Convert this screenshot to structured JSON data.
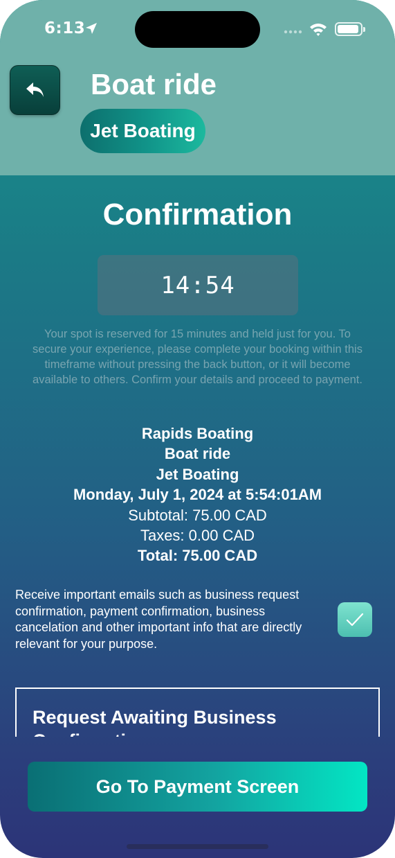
{
  "status_bar": {
    "time": "6:13"
  },
  "header": {
    "title": "Boat ride",
    "chip_label": "Jet Boating"
  },
  "confirmation": {
    "heading": "Confirmation",
    "timer": "14:54",
    "notice": "Your spot is reserved for 15 minutes and held just for you. To secure your experience, please complete your booking within this timeframe without pressing the back button, or it will become available to others. Confirm your details and proceed to payment."
  },
  "summary": {
    "business": "Rapids Boating",
    "activity": "Boat ride",
    "option": "Jet Boating",
    "datetime": "Monday, July 1, 2024 at 5:54:01AM",
    "subtotal": "Subtotal: 75.00 CAD",
    "taxes": "Taxes: 0.00 CAD",
    "total": "Total: 75.00 CAD"
  },
  "consent": {
    "text": "Receive important emails such as business request confirmation, payment confirmation, business cancelation and other important info that are directly relevant for your purpose.",
    "checked": true
  },
  "status_box": {
    "text": "Request Awaiting Business Confirmation"
  },
  "actions": {
    "pay_label": "Go To Payment Screen"
  },
  "icons": {
    "back": "reply-arrow-icon",
    "location": "location-arrow-icon",
    "wifi": "wifi-icon",
    "battery": "battery-icon",
    "check": "checkmark-icon"
  },
  "colors": {
    "header_bg": "#6fb1aa",
    "gradient_top": "#17968c",
    "gradient_bottom": "#2c3478",
    "accent": "#03e6c4"
  }
}
